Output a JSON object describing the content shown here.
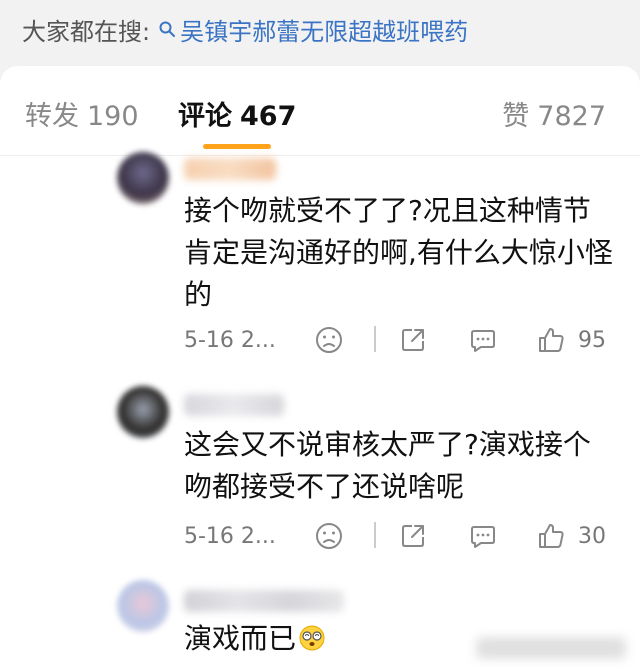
{
  "search": {
    "label": "大家都在搜:",
    "hot_query": "吴镇宇郝蕾无限超越班喂药"
  },
  "tabs": [
    {
      "label": "转发",
      "count": "190"
    },
    {
      "label": "评论",
      "count": "467"
    },
    {
      "label": "赞",
      "count": "7827"
    }
  ],
  "comments": [
    {
      "text": "接个吻就受不了了?况且这种情节肯定是沟通好的啊,有什么大惊小怪的",
      "time": "5-16 2...",
      "likes": "95"
    },
    {
      "text": "这会又不说审核太严了?演戏接个吻都接受不了还说啥呢",
      "time": "5-16 2...",
      "likes": "30"
    },
    {
      "text": "演戏而已"
    }
  ],
  "colors": {
    "accent": "#ffa31a",
    "link": "#3b74c4"
  }
}
